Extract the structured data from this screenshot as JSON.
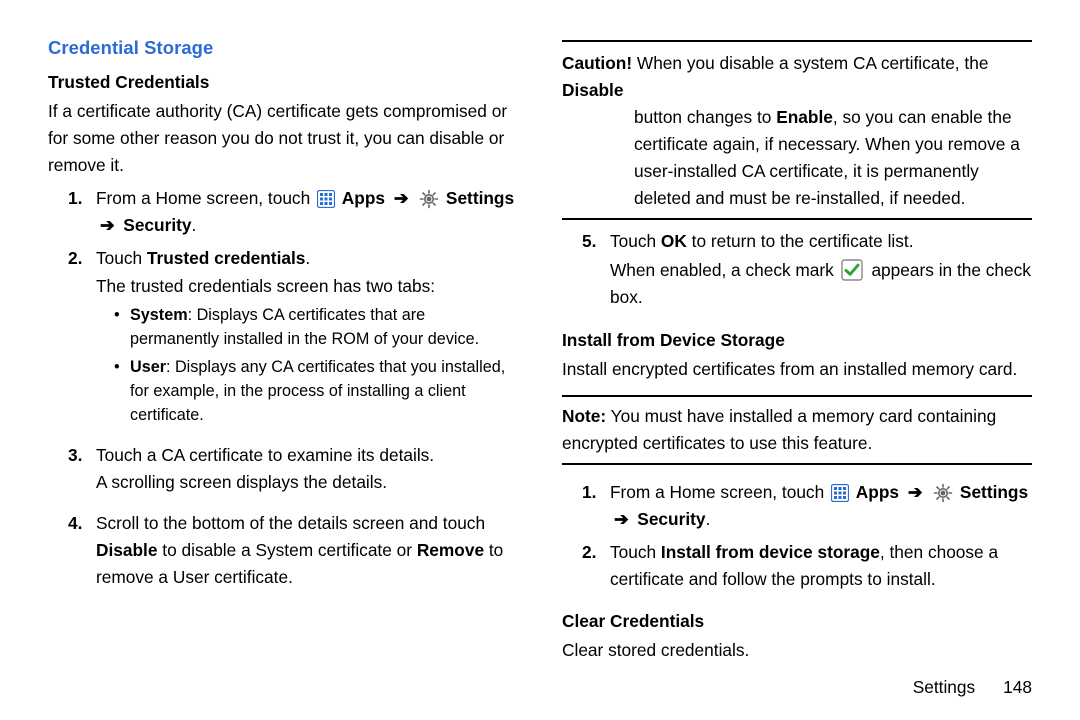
{
  "section_title": "Credential Storage",
  "trusted_heading": "Trusted Credentials",
  "trusted_intro": "If a certificate authority (CA) certificate gets compromised or for some other reason you do not trust it, you can disable or remove it.",
  "step1_pre": "From a Home screen, touch ",
  "apps_label": "Apps",
  "arrow": "➔",
  "settings_label": "Settings",
  "security_suffix": "Security",
  "period": ".",
  "step2_a": "Touch ",
  "step2_bold": "Trusted credentials",
  "step2_b": ".",
  "step2_line2": "The trusted credentials screen has two tabs:",
  "bullet_system_lead": "System",
  "bullet_system_text": ": Displays CA certificates that are permanently installed in the ROM of your device.",
  "bullet_user_lead": "User",
  "bullet_user_text": ": Displays any CA certificates that you installed, for example, in the process of installing a client certificate.",
  "step3_l1": "Touch a CA certificate to examine its details.",
  "step3_l2": "A scrolling screen displays the details.",
  "step4_a": "Scroll to the bottom of the details screen and touch ",
  "step4_disable": "Disable",
  "step4_b": " to disable a System certificate or ",
  "step4_remove": "Remove",
  "step4_c": " to remove a User certificate.",
  "caution_lead": "Caution!",
  "caution_a": " When you disable a system CA certificate, the ",
  "caution_disable": "Disable",
  "caution_b": " button changes to ",
  "caution_enable": "Enable",
  "caution_c": ", so you can enable the certificate again, if necessary. When you remove a user-installed CA certificate, it is permanently deleted and must be re-installed, if needed.",
  "step5_a": "Touch ",
  "step5_ok": "OK",
  "step5_b": " to return to the certificate list.",
  "step5_l2a": "When enabled, a check mark ",
  "step5_l2b": " appears in the check box.",
  "install_heading": "Install from Device Storage",
  "install_intro": "Install encrypted certificates from an installed memory card.",
  "note_lead": "Note:",
  "note_text": " You must have installed a memory card containing encrypted certificates to use this feature.",
  "install_step2_a": "Touch ",
  "install_step2_bold": "Install from device storage",
  "install_step2_b": ", then choose a certificate and follow the prompts to install.",
  "clear_heading": "Clear Credentials",
  "clear_text": "Clear stored credentials.",
  "footer_section": "Settings",
  "footer_page": "148"
}
